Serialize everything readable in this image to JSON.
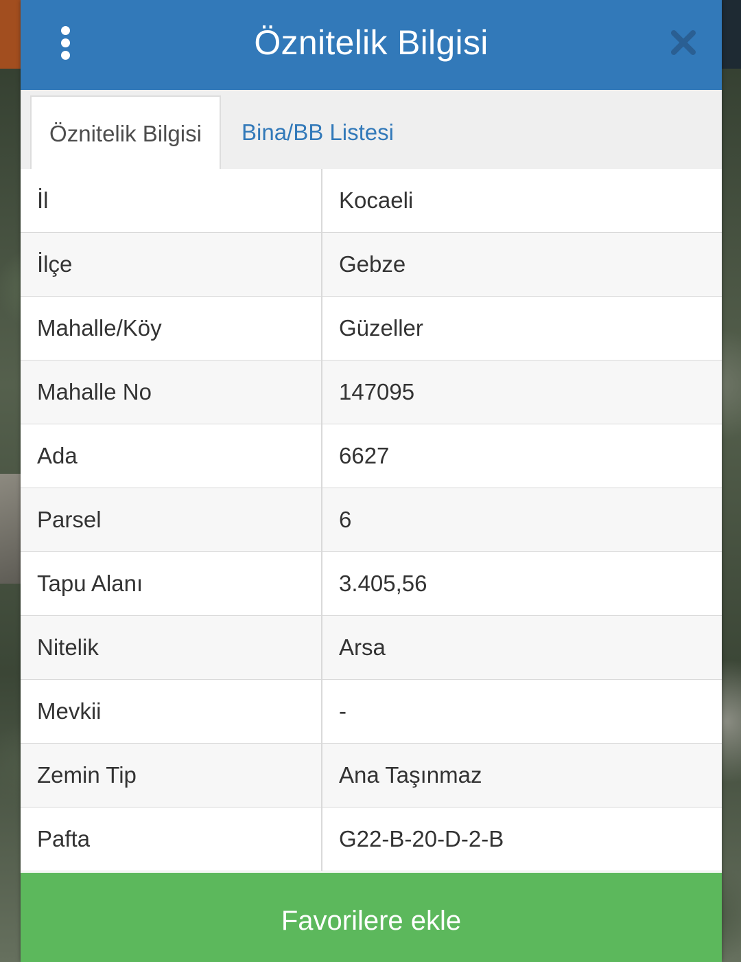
{
  "header": {
    "title": "Öznitelik Bilgisi",
    "menu_icon": "more-vertical-icon",
    "close_icon": "close-icon"
  },
  "tabs": [
    {
      "label": "Öznitelik Bilgisi",
      "active": true
    },
    {
      "label": "Bina/BB Listesi",
      "active": false
    }
  ],
  "attributes": [
    {
      "key": "İl",
      "value": "Kocaeli"
    },
    {
      "key": "İlçe",
      "value": "Gebze"
    },
    {
      "key": "Mahalle/Köy",
      "value": "Güzeller"
    },
    {
      "key": "Mahalle No",
      "value": "147095"
    },
    {
      "key": "Ada",
      "value": "6627"
    },
    {
      "key": "Parsel",
      "value": "6"
    },
    {
      "key": "Tapu Alanı",
      "value": "3.405,56"
    },
    {
      "key": "Nitelik",
      "value": "Arsa"
    },
    {
      "key": "Mevkii",
      "value": "-"
    },
    {
      "key": "Zemin Tip",
      "value": "Ana Taşınmaz"
    },
    {
      "key": "Pafta",
      "value": "G22-B-20-D-2-B"
    }
  ],
  "footer": {
    "favorite_label": "Favorilere ekle"
  },
  "colors": {
    "header_bg": "#3279b9",
    "tab_link": "#3279b9",
    "favorite_bg": "#5cb85c",
    "close_icon": "#2a5f93"
  }
}
